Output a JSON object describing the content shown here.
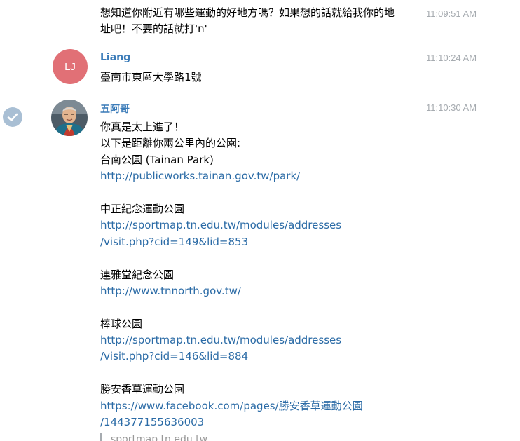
{
  "messages": [
    {
      "lines": [
        "想知道你附近有哪些運動的好地方嗎？如果想的話就給我你的地",
        "址吧！不要的話就打'n'"
      ],
      "time": "11:09:51 AM"
    },
    {
      "sender": "Liang",
      "avatar_initials": "LJ",
      "lines": [
        "臺南市東區大學路1號"
      ],
      "time": "11:10:24 AM"
    },
    {
      "sender": "五阿哥",
      "time": "11:10:30 AM",
      "intro": [
        "你真是太上進了！",
        "以下是距離你兩公里內的公園:"
      ],
      "parks": [
        {
          "name": "台南公園 (Tainan Park)",
          "url_lines": [
            "http://publicworks.tainan.gov.tw/park/"
          ]
        },
        {
          "name": "中正紀念運動公園",
          "url_lines": [
            "http://sportmap.tn.edu.tw/modules/addresses",
            "/visit.php?cid=149&lid=853"
          ]
        },
        {
          "name": "連雅堂紀念公園",
          "url_lines": [
            "http://www.tnnorth.gov.tw/"
          ]
        },
        {
          "name": "棒球公園",
          "url_lines": [
            "http://sportmap.tn.edu.tw/modules/addresses",
            "/visit.php?cid=146&lid=884"
          ]
        },
        {
          "name": "勝安香草運動公園",
          "url_lines": [
            "https://www.facebook.com/pages/勝安香草運動公園",
            "/144377155636003"
          ]
        }
      ],
      "link_preview": "sportmap.tn.edu.tw"
    }
  ],
  "colors": {
    "link": "#2b6ba6",
    "sender_name": "#3a7bb8",
    "timestamp": "#a6abb0",
    "avatar_lj": "#e17076",
    "selection_check": "#a9bfd4"
  }
}
